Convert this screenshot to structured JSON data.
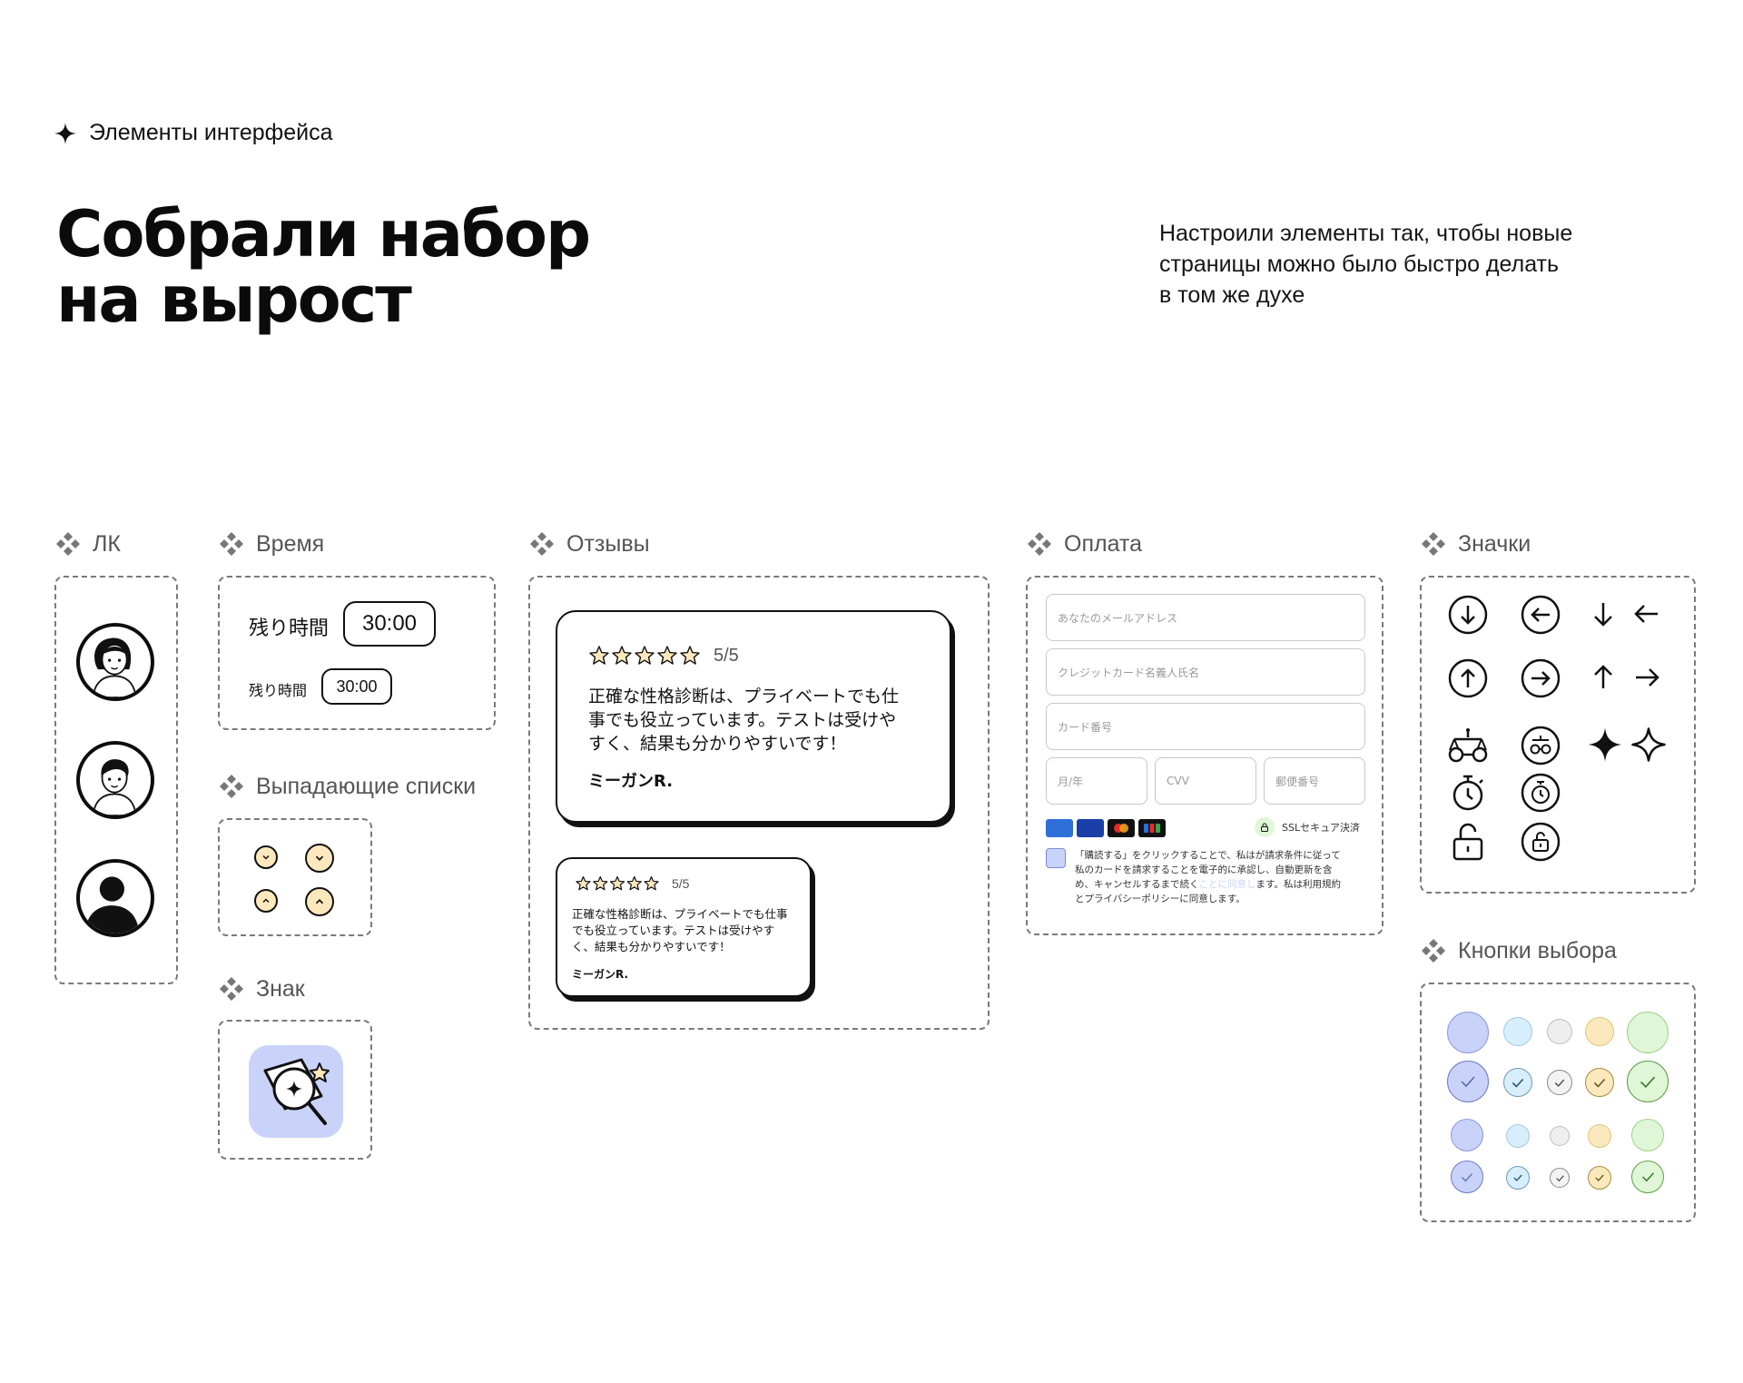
{
  "kicker": "Элементы интерфейса",
  "headline": {
    "line1": "Собрали набор",
    "line2": "на вырост"
  },
  "lead": {
    "line1": "Настроили элементы так, чтобы новые",
    "line2": "страницы можно было быстро делать",
    "line3": "в том же духе"
  },
  "sections": {
    "lk": "ЛК",
    "time": "Время",
    "dropdowns": "Выпадающие списки",
    "sign": "Знак",
    "reviews": "Отзывы",
    "payment": "Оплата",
    "icons": "Значки",
    "radios": "Кнопки выбора"
  },
  "time_widget": {
    "large_label": "残り時間",
    "large_value": "30:00",
    "small_label": "残り時間",
    "small_value": "30:00"
  },
  "reviews": {
    "large": {
      "rating": "5/5",
      "line1": "正確な性格診断は、プライベートでも仕",
      "line2": "事でも役立っています。テストは受けや",
      "line3": "すく、結果も分かりやすいです！",
      "author": "ミーガンR."
    },
    "small": {
      "rating": "5/5",
      "line1": "正確な性格診断は、プライベートでも仕事",
      "line2": "でも役立っています。テストは受けやす",
      "line3": "く、結果も分かりやすいです！",
      "author": "ミーガンR."
    }
  },
  "payment": {
    "email_placeholder": "あなたのメールアドレス",
    "cardholder_placeholder": "クレジットカード名義人氏名",
    "card_number_placeholder": "カード番号",
    "expiry_placeholder": "月/年",
    "cvv_placeholder": "CVV",
    "zip_placeholder": "郵便番号",
    "card_brands": [
      "AMEX",
      "VISA",
      "Mastercard",
      "JCB"
    ],
    "ssl_label": "SSLセキュア決済",
    "consent": {
      "line1": "「購読する」をクリックすることで、私はが請求条件に従って",
      "line2": "私のカードを請求することを電子的に承認し、自動更新を含",
      "line3a": "め、キャンセルするまで続く",
      "line3link": "ことに同意し",
      "line3b": "ます。私は利用規約",
      "line4": "とプライバシーポリシーに同意します。"
    }
  },
  "icons": [
    "arrow-down-circle-icon",
    "arrow-left-circle-icon",
    "arrow-down-icon",
    "arrow-left-icon",
    "arrow-up-circle-icon",
    "arrow-right-circle-icon",
    "arrow-up-icon",
    "arrow-right-icon",
    "scales-icon",
    "scales-circle-icon",
    "sparkle-filled-icon",
    "sparkle-outline-icon",
    "stopwatch-icon",
    "stopwatch-circle-icon",
    "unlock-icon",
    "unlock-circle-icon"
  ],
  "colors": {
    "accent_blue": "#c9d3fa",
    "light_blue": "#d7effd",
    "light_gray": "#eeeeee",
    "light_yellow": "#fbe9bd",
    "light_green": "#dff7d6",
    "ink": "#111111",
    "dash": "#7a7a7a"
  }
}
